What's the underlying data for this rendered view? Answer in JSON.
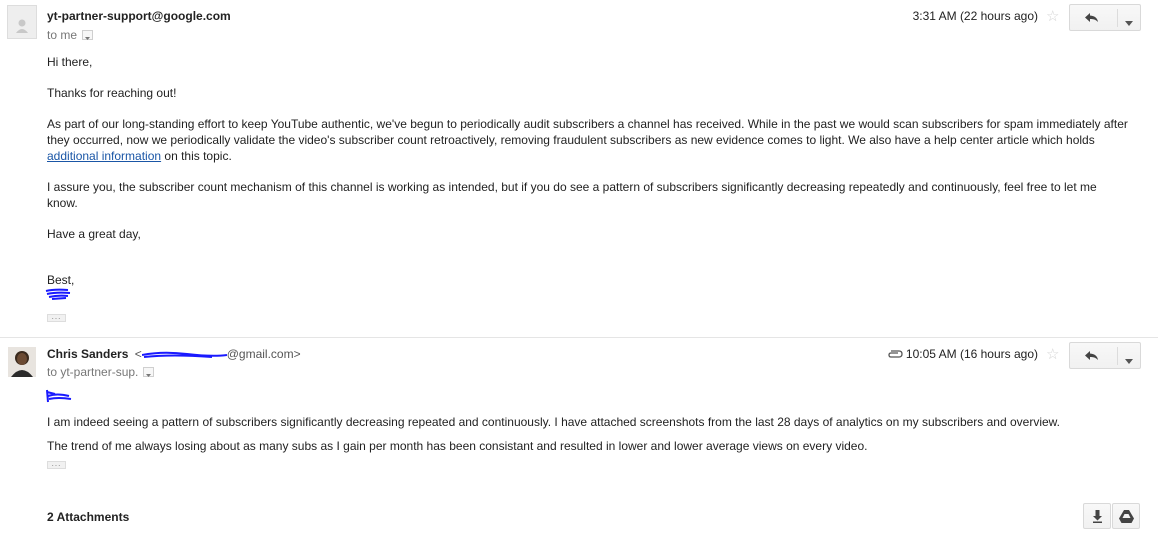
{
  "message1": {
    "sender": "yt-partner-support@google.com",
    "to": "to me",
    "time": "3:31 AM (22 hours ago)",
    "greeting": "Hi there,",
    "p1": "Thanks for reaching out!",
    "p2a": "As part of our long-standing effort to keep YouTube authentic, we've begun to periodically audit subscribers a channel has received. While in the past we would scan subscribers for spam immediately after they occurred, now we periodically validate the video's subscriber count retroactively, removing fraudulent subscribers as new evidence comes to light. We also have a help center article which holds ",
    "p2_link": "additional information",
    "p2b": " on this topic.",
    "p3": "I assure you, the subscriber count mechanism of this channel is working as intended, but if you do see a pattern of subscribers significantly decreasing repeatedly and continuously, feel free to let me know.",
    "p4": "Have a great day,",
    "signoff": "Best,"
  },
  "message2": {
    "sender_name": "Chris Sanders",
    "sender_email_open": "<",
    "sender_email_domain": "@gmail.com>",
    "to": "to yt-partner-sup.",
    "time": "10:05 AM (16 hours ago)",
    "p1": " I am indeed seeing a pattern of subscribers significantly decreasing repeated and continuously.  I have attached screenshots from the last 28 days of analytics on my subscribers and overview.",
    "p2": "The trend of me always losing about as many subs as I gain per month has been consistant and resulted in lower and lower average views on every video."
  },
  "attachments": {
    "title": "2 Attachments"
  },
  "icons": {
    "reply": "reply-icon",
    "more": "chevron-down-icon",
    "star": "star-icon",
    "paperclip": "paperclip-icon",
    "download": "download-icon",
    "drive": "drive-icon"
  },
  "colors": {
    "link": "#1a56a6",
    "redaction": "#1a1aff"
  }
}
